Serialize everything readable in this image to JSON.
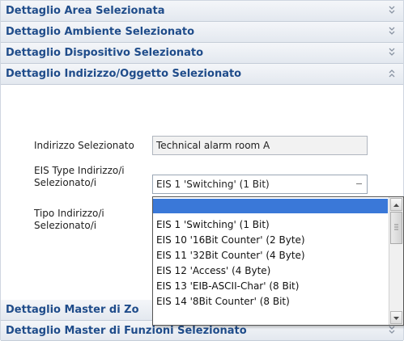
{
  "sections": [
    {
      "title": "Dettaglio Area Selezionata",
      "icon": "double-chevron-down-icon"
    },
    {
      "title": "Dettaglio Ambiente Selezionato",
      "icon": "double-chevron-down-icon"
    },
    {
      "title": "Dettaglio Dispositivo Selezionato",
      "icon": "double-chevron-down-icon"
    },
    {
      "title": "Dettaglio Indizizzo/Oggetto Selezionato",
      "icon": "double-chevron-up-icon"
    },
    {
      "title": "Dettaglio Master di Zo",
      "icon": "double-chevron-down-icon"
    },
    {
      "title": "Dettaglio Master di Funzioni Selezionato",
      "icon": "double-chevron-down-icon"
    }
  ],
  "form": {
    "indirizzo_label": "Indirizzo Selezionato",
    "indirizzo_value": "Technical alarm room A",
    "eis_label_line1": "EIS Type Indirizzo/i",
    "eis_label_line2": "Selezionato/i",
    "eis_selected": "EIS 1 'Switching' (1 Bit)",
    "tipo_label_line1": "Tipo Indirizzo/i",
    "tipo_label_line2": "Selezionato/i"
  },
  "dropdown": {
    "options": [
      "",
      "EIS 1 'Switching' (1 Bit)",
      "EIS 10 '16Bit Counter' (2 Byte)",
      "EIS 11 '32Bit Counter' (4 Byte)",
      "EIS 12 'Access' (4 Byte)",
      "EIS 13 'EIB-ASCII-Char' (8 Bit)",
      "EIS 14 '8Bit Counter' (8 Bit)"
    ],
    "highlighted_index": 0
  },
  "colors": {
    "header_text": "#1f4c8a",
    "highlight": "#3a78d8"
  }
}
